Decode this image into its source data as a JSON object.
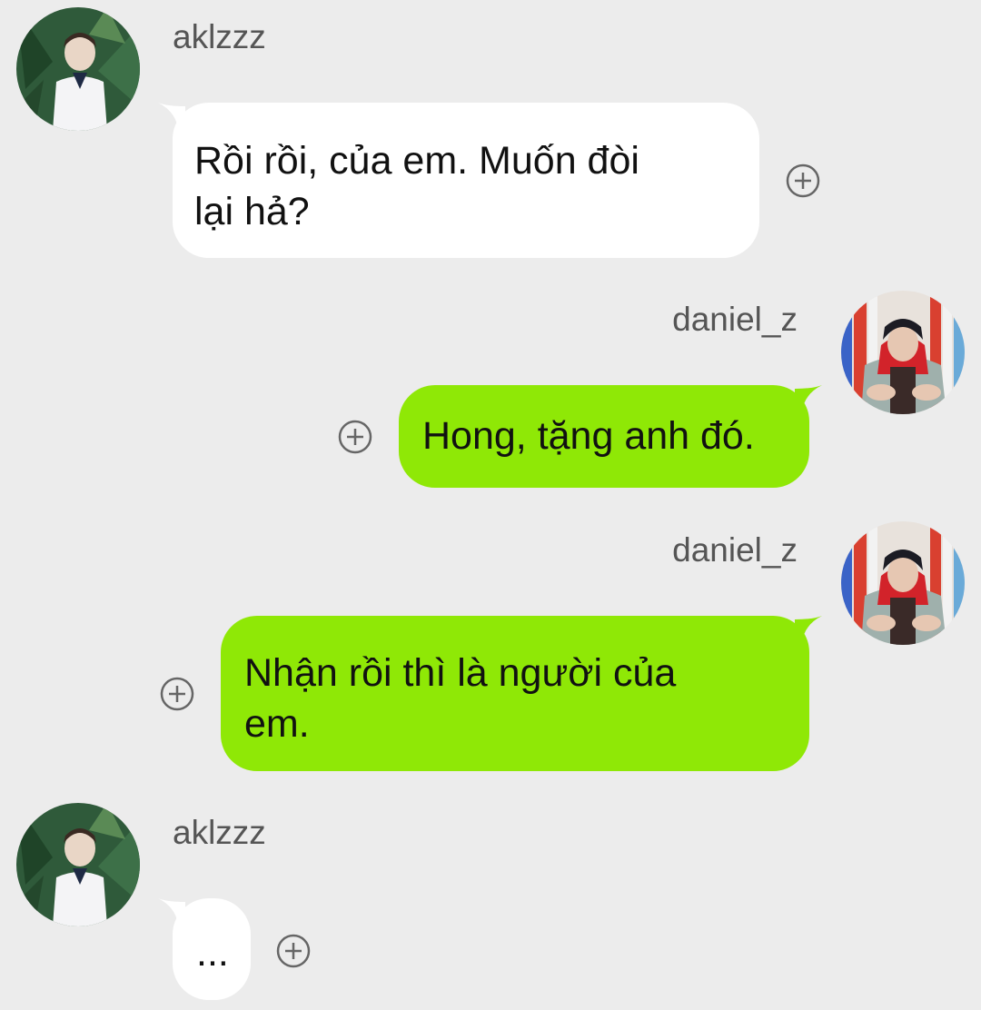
{
  "messages": [
    {
      "sender": "aklzzz",
      "text_lines": [
        "Rồi rồi, của em. Muốn đòi",
        "lại hả?"
      ]
    },
    {
      "sender": "daniel_z",
      "text_lines": [
        "Hong, tặng anh đó."
      ]
    },
    {
      "sender": "daniel_z",
      "text_lines": [
        "Nhận rồi thì là người của",
        "em."
      ]
    },
    {
      "sender": "aklzzz",
      "text_lines": [
        "..."
      ]
    }
  ],
  "colors": {
    "background": "#ececec",
    "incoming_bubble": "#ffffff",
    "outgoing_bubble": "#8fe806",
    "sender_text": "#555555",
    "message_text": "#111111",
    "action_icon": "#666666"
  },
  "icons": {
    "add_action": "plus-circle-icon"
  }
}
